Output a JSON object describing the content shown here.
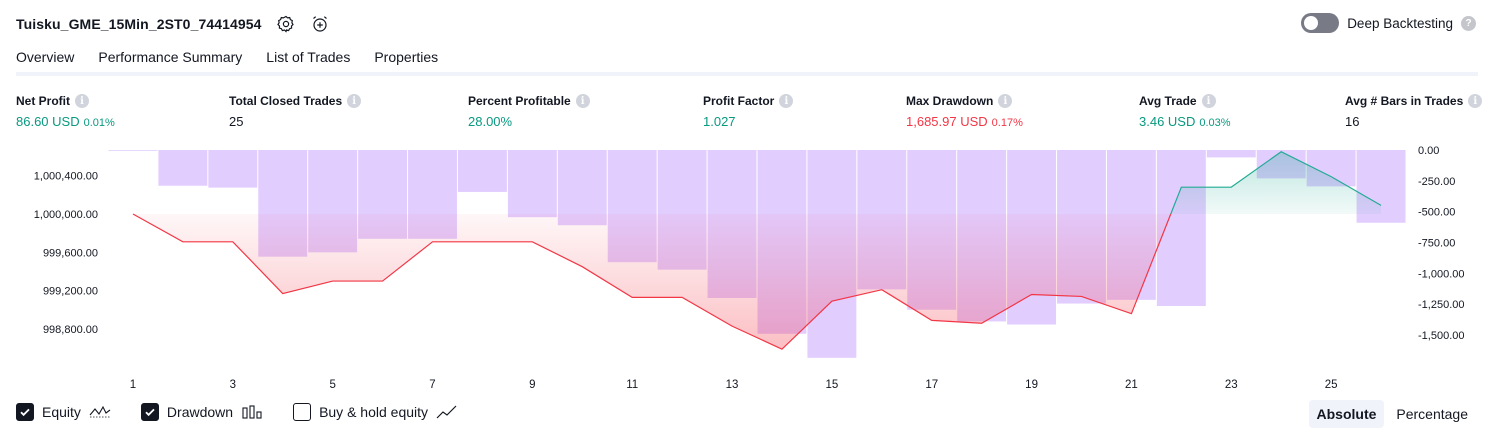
{
  "header": {
    "title": "Tuisku_GME_15Min_2ST0_74414954",
    "settings_icon": "gear-icon",
    "alert_icon": "alarm-clock-plus-icon",
    "deep_backtesting_label": "Deep Backtesting",
    "deep_backtesting_on": false,
    "help_glyph": "?"
  },
  "tabs": [
    {
      "label": "Overview",
      "active": true
    },
    {
      "label": "Performance Summary",
      "active": false
    },
    {
      "label": "List of Trades",
      "active": false
    },
    {
      "label": "Properties",
      "active": false
    }
  ],
  "metrics": [
    {
      "label": "Net Profit",
      "value": "86.60 USD",
      "pct": "0.01%",
      "color": "#089981"
    },
    {
      "label": "Total Closed Trades",
      "value": "25",
      "pct": "",
      "color": "#131722"
    },
    {
      "label": "Percent Profitable",
      "value": "28.00%",
      "pct": "",
      "color": "#089981"
    },
    {
      "label": "Profit Factor",
      "value": "1.027",
      "pct": "",
      "color": "#089981"
    },
    {
      "label": "Max Drawdown",
      "value": "1,685.97 USD",
      "pct": "0.17%",
      "color": "#f23645"
    },
    {
      "label": "Avg Trade",
      "value": "3.46 USD",
      "pct": "0.03%",
      "color": "#089981"
    },
    {
      "label": "Avg # Bars in Trades",
      "value": "16",
      "pct": "",
      "color": "#131722"
    }
  ],
  "info_glyph": "i",
  "chart_data": {
    "type": "line",
    "description_series": [
      {
        "name": "Equity",
        "axis": "left"
      },
      {
        "name": "Drawdown",
        "axis": "right"
      }
    ],
    "x_ticks": [
      "1",
      "3",
      "5",
      "7",
      "9",
      "11",
      "13",
      "15",
      "17",
      "19",
      "21",
      "23",
      "25"
    ],
    "left_axis": {
      "ticks": [
        "1,000,400.00",
        "1,000,000.00",
        "999,600.00",
        "999,200.00",
        "998,800.00"
      ],
      "ylim": [
        998,
        600,
        1000650
      ]
    },
    "right_axis": {
      "ticks": [
        "0.00",
        "-250.00",
        "-500.00",
        "-750.00",
        "-1,000.00",
        "-1,250.00",
        "-1,500.00"
      ],
      "ylim": [
        -1700,
        0
      ]
    },
    "equity": {
      "x": [
        1,
        2,
        3,
        4,
        5,
        6,
        7,
        8,
        9,
        10,
        11,
        12,
        13,
        14,
        15,
        16,
        17,
        18,
        19,
        20,
        21,
        22,
        23,
        24,
        25,
        26
      ],
      "values": [
        1000000,
        999710,
        999710,
        999170,
        999300,
        999300,
        999710,
        999710,
        999710,
        999450,
        999130,
        999130,
        998830,
        998590,
        999090,
        999210,
        998890,
        998860,
        999160,
        999140,
        998960,
        1000280,
        1000280,
        1000650,
        1000390,
        1000090
      ]
    },
    "drawdown": {
      "x": [
        1,
        2,
        3,
        4,
        5,
        6,
        7,
        8,
        9,
        10,
        11,
        12,
        13,
        14,
        15,
        16,
        17,
        18,
        19,
        20,
        21,
        22,
        23,
        24,
        25,
        26
      ],
      "values": [
        0,
        -290,
        -305,
        -865,
        -830,
        -720,
        -720,
        -340,
        -545,
        -610,
        -910,
        -970,
        -1200,
        -1490,
        -1685,
        -1130,
        -1295,
        -1390,
        -1415,
        -1245,
        -1215,
        -1265,
        -60,
        -230,
        -295,
        -590
      ]
    },
    "colors": {
      "equity_up": "#22ab94",
      "equity_down": "#f23645",
      "drawdown": "#ddc4ff"
    }
  },
  "legend": [
    {
      "label": "Equity",
      "checked": true,
      "glyph": "equity-line-icon"
    },
    {
      "label": "Drawdown",
      "checked": true,
      "glyph": "bars-icon"
    },
    {
      "label": "Buy & hold equity",
      "checked": false,
      "glyph": "trend-line-icon"
    }
  ],
  "modes": [
    {
      "label": "Absolute",
      "active": true
    },
    {
      "label": "Percentage",
      "active": false
    }
  ]
}
